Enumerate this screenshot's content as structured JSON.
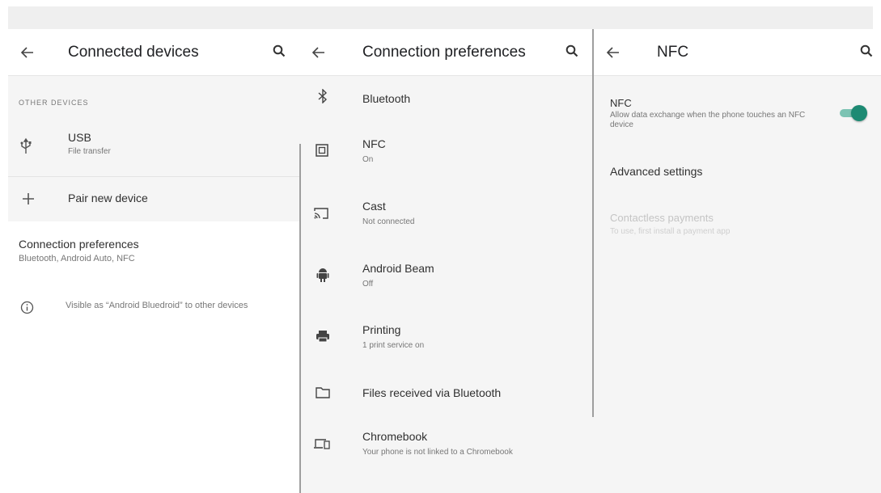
{
  "pane1": {
    "title": "Connected devices",
    "section_header": "OTHER DEVICES",
    "usb": {
      "title": "USB",
      "subtitle": "File transfer"
    },
    "pair": {
      "title": "Pair new device"
    },
    "prefs": {
      "title": "Connection preferences",
      "subtitle": "Bluetooth, Android Auto, NFC"
    },
    "info": {
      "text": "Visible as “Android Bluedroid” to other devices"
    }
  },
  "pane2": {
    "title": "Connection preferences",
    "items": [
      {
        "title": "Bluetooth",
        "subtitle": "",
        "icon": "bluetooth-icon"
      },
      {
        "title": "NFC",
        "subtitle": "On",
        "icon": "nfc-icon"
      },
      {
        "title": "Cast",
        "subtitle": "Not connected",
        "icon": "cast-icon"
      },
      {
        "title": "Android Beam",
        "subtitle": "Off",
        "icon": "android-icon"
      },
      {
        "title": "Printing",
        "subtitle": "1 print service on",
        "icon": "printer-icon"
      },
      {
        "title": "Files received via Bluetooth",
        "subtitle": "",
        "icon": "folder-icon"
      },
      {
        "title": "Chromebook",
        "subtitle": "Your phone is not linked to a Chromebook",
        "icon": "devices-icon"
      }
    ]
  },
  "pane3": {
    "title": "NFC",
    "nfc": {
      "title": "NFC",
      "subtitle": "Allow data exchange when the phone touches an NFC device",
      "enabled": true
    },
    "advanced": {
      "title": "Advanced settings"
    },
    "contactless": {
      "title": "Contactless payments",
      "subtitle": "To use, first install a payment app"
    }
  },
  "colors": {
    "accent": "#1d8a73",
    "accent_track": "#7cc3b3",
    "pane_bg": "#f5f5f5"
  }
}
